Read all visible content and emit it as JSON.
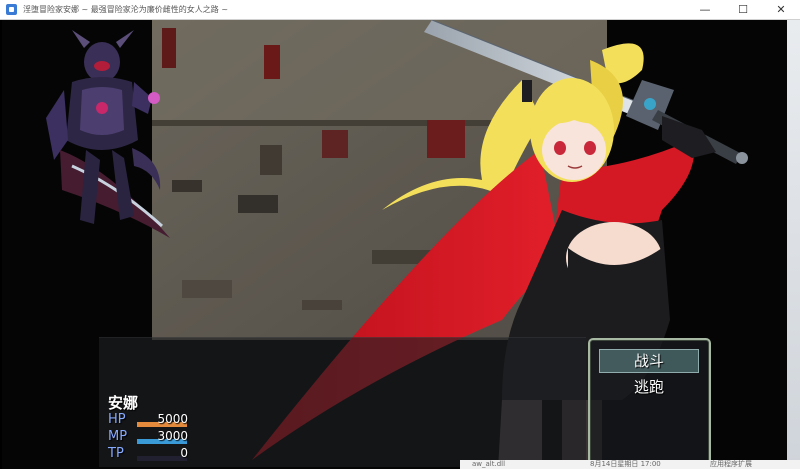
{
  "window": {
    "title": "淫堕冒险家安娜 ~ 最强冒险家沦为廉价雌性的女人之路 ~",
    "controls": [
      "—",
      "☐",
      "✕"
    ]
  },
  "battle": {
    "enemy_name": "",
    "actor": {
      "name": "安娜",
      "hp": {
        "label": "HP",
        "value": "5000",
        "ratio": 1.0,
        "color": "#e38a3c"
      },
      "mp": {
        "label": "MP",
        "value": "3000",
        "ratio": 1.0,
        "color": "#3a9ad8"
      },
      "tp": {
        "label": "TP",
        "value": "0",
        "ratio": 0.0,
        "color": "#4a8a40"
      }
    },
    "label_colors": {
      "hp": "#88aaff",
      "mp": "#88aaff",
      "tp": "#88aaff"
    },
    "commands": [
      {
        "label": "战斗",
        "selected": true
      },
      {
        "label": "逃跑",
        "selected": false
      }
    ]
  },
  "taskbar": {
    "item1": "aw_alt.dll",
    "item2": "8月14日星期日 17:00",
    "item3": "应用程序扩展"
  },
  "colors": {
    "cape_red": "#d41824",
    "hair_yellow": "#f3df5a",
    "dress_black": "#1c1c1e",
    "armor_purple": "#3a2f56"
  },
  "icons": [
    "app-icon",
    "minimize-icon",
    "maximize-icon",
    "close-icon",
    "sword-icon"
  ]
}
